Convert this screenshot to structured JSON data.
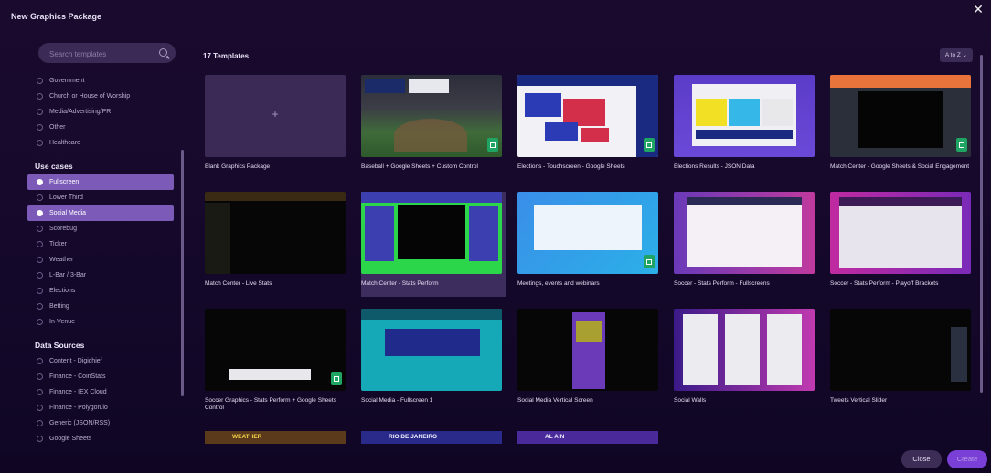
{
  "window": {
    "title": "New Graphics Package"
  },
  "search": {
    "placeholder": "Search templates"
  },
  "industries": [
    {
      "label": "Government",
      "selected": false
    },
    {
      "label": "Church or House of Worship",
      "selected": false
    },
    {
      "label": "Media/Advertising/PR",
      "selected": false
    },
    {
      "label": "Other",
      "selected": false
    },
    {
      "label": "Healthcare",
      "selected": false
    }
  ],
  "use_cases": {
    "title": "Use cases",
    "items": [
      {
        "label": "Fullscreen",
        "selected": true
      },
      {
        "label": "Lower Third",
        "selected": false
      },
      {
        "label": "Social Media",
        "selected": true
      },
      {
        "label": "Scorebug",
        "selected": false
      },
      {
        "label": "Ticker",
        "selected": false
      },
      {
        "label": "Weather",
        "selected": false
      },
      {
        "label": "L-Bar / 3-Bar",
        "selected": false
      },
      {
        "label": "Elections",
        "selected": false
      },
      {
        "label": "Betting",
        "selected": false
      },
      {
        "label": "In-Venue",
        "selected": false
      }
    ]
  },
  "data_sources": {
    "title": "Data Sources",
    "items": [
      {
        "label": "Content - Digichief",
        "selected": false
      },
      {
        "label": "Finance - CoinStats",
        "selected": false
      },
      {
        "label": "Finance - IEX Cloud",
        "selected": false
      },
      {
        "label": "Finance - Polygon.io",
        "selected": false
      },
      {
        "label": "Generic (JSON/RSS)",
        "selected": false
      },
      {
        "label": "Google Sheets",
        "selected": false
      }
    ]
  },
  "main": {
    "count_label": "17 Templates",
    "sort_label": "A to Z ⌄",
    "templates": [
      {
        "label": "Blank Graphics Package"
      },
      {
        "label": "Baseball + Google Sheets + Custom Control"
      },
      {
        "label": "Elections - Touchscreen - Google Sheets"
      },
      {
        "label": "Elections Results - JSON Data"
      },
      {
        "label": "Match Center - Google Sheets & Social Engagement"
      },
      {
        "label": "Match Center - Live Stats"
      },
      {
        "label": "Match Center - Stats Perform"
      },
      {
        "label": "Meetings, events and webinars"
      },
      {
        "label": "Soccer - Stats Perform - Fullscreens"
      },
      {
        "label": "Soccer - Stats Perform - Playoff Brackets"
      },
      {
        "label": "Soccer Graphics - Stats Perform + Google Sheets Control"
      },
      {
        "label": "Social Media - Fullscreen 1"
      },
      {
        "label": "Social Media Vertical Screen"
      },
      {
        "label": "Social Walls"
      },
      {
        "label": "Tweets Vertical Slider"
      }
    ],
    "partial_cards": [
      {
        "label": "WEATHER"
      },
      {
        "label": "RIO DE JANEIRO"
      },
      {
        "label": "AL AIN"
      }
    ]
  },
  "footer": {
    "close_label": "Close",
    "create_label": "Create"
  },
  "colors": {
    "accent": "#7c5bb8",
    "create": "#7a3fd6",
    "sheets": "#1fa463"
  }
}
